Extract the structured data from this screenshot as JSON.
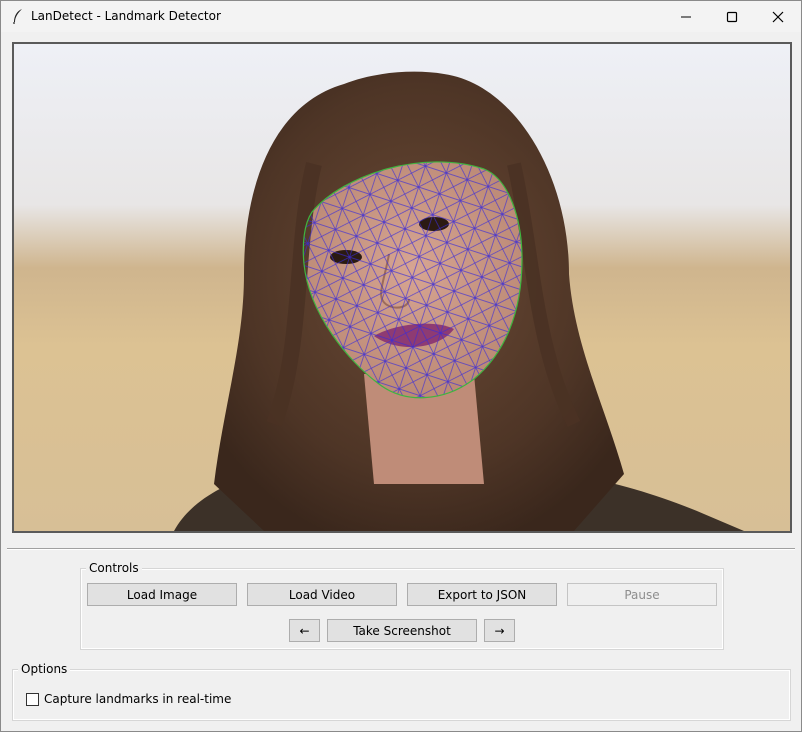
{
  "window": {
    "title": "LanDetect - Landmark Detector",
    "icons": {
      "app": "feather-icon",
      "minimize": "minimize-icon",
      "maximize": "maximize-icon",
      "close": "close-icon"
    }
  },
  "canvas": {
    "content": "photo-with-face-landmark-mesh",
    "colors": {
      "mesh": "#3a2bd9",
      "contour": "#3fb53f"
    }
  },
  "controls": {
    "label": "Controls",
    "load_image": "Load Image",
    "load_video": "Load Video",
    "export_json": "Export to JSON",
    "pause": "Pause",
    "prev": "←",
    "take_screenshot": "Take Screenshot",
    "next": "→"
  },
  "options": {
    "label": "Options",
    "realtime_label": "Capture landmarks in real-time",
    "realtime_checked": false
  }
}
